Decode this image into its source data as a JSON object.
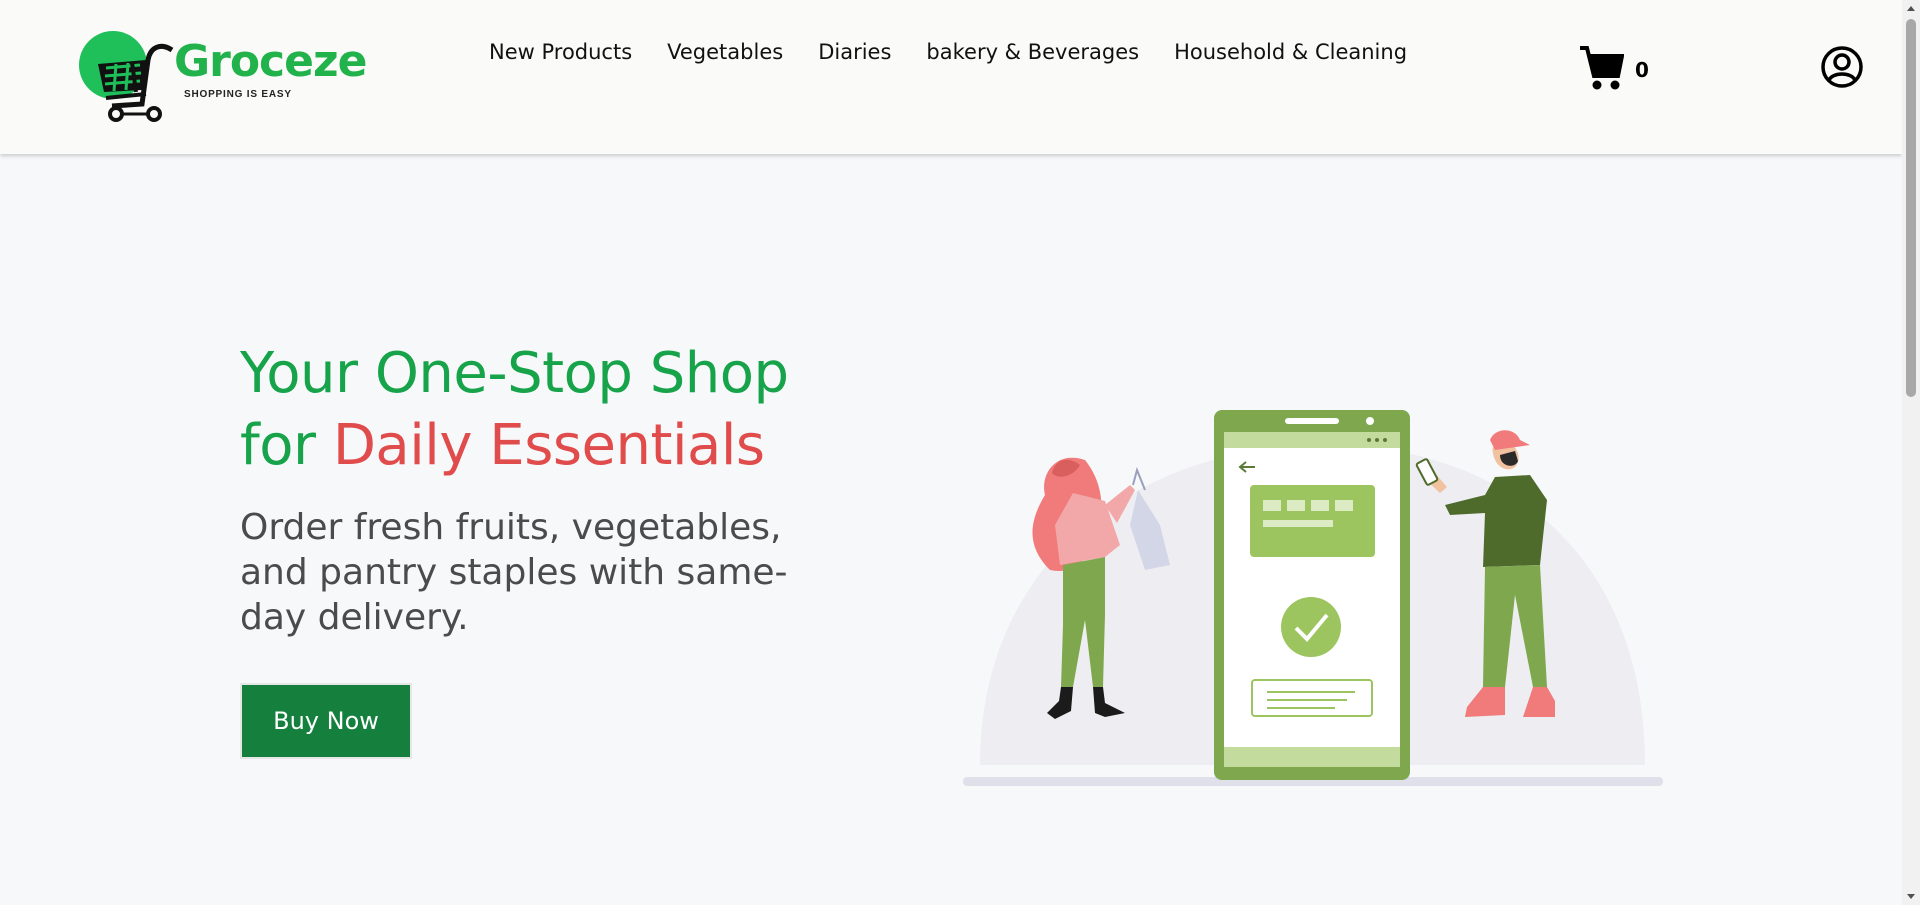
{
  "brand": {
    "name": "Groceze",
    "tagline": "SHOPPING IS EASY"
  },
  "nav": {
    "links": [
      "New Products",
      "Vegetables",
      "Diaries",
      "bakery & Beverages",
      "Household & Cleaning"
    ]
  },
  "cart": {
    "count": "0",
    "icon": "cart-icon"
  },
  "account": {
    "icon": "user-circle-icon"
  },
  "hero": {
    "title_line1": "Your One-Stop Shop",
    "title_for": "for",
    "title_accent": "Daily Essentials",
    "description": "Order fresh fruits, vegetables, and pantry staples with same-day delivery.",
    "cta_label": "Buy Now"
  },
  "colors": {
    "brand_green": "#16a34a",
    "accent_red": "#e04b4b",
    "button_green": "#15803d",
    "illustration_green": "#7fa84e"
  }
}
